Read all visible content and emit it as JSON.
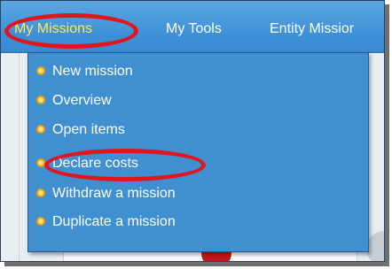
{
  "menubar": {
    "items": [
      {
        "label": "My Missions"
      },
      {
        "label": "My Tools"
      },
      {
        "label": "Entity Missior"
      }
    ]
  },
  "dropdown": {
    "items": [
      {
        "label": "New mission"
      },
      {
        "label": "Overview"
      },
      {
        "label": "Open items"
      },
      {
        "label": "Declare costs"
      },
      {
        "label": "Withdraw a mission"
      },
      {
        "label": "Duplicate a mission"
      }
    ]
  },
  "colors": {
    "menubar_bg": "#3d8fd6",
    "active_menu_text": "#ffe85a",
    "highlight": "#e0161d",
    "bullet": "#f4a000"
  },
  "icons": {
    "bullet": "bullet-icon"
  }
}
